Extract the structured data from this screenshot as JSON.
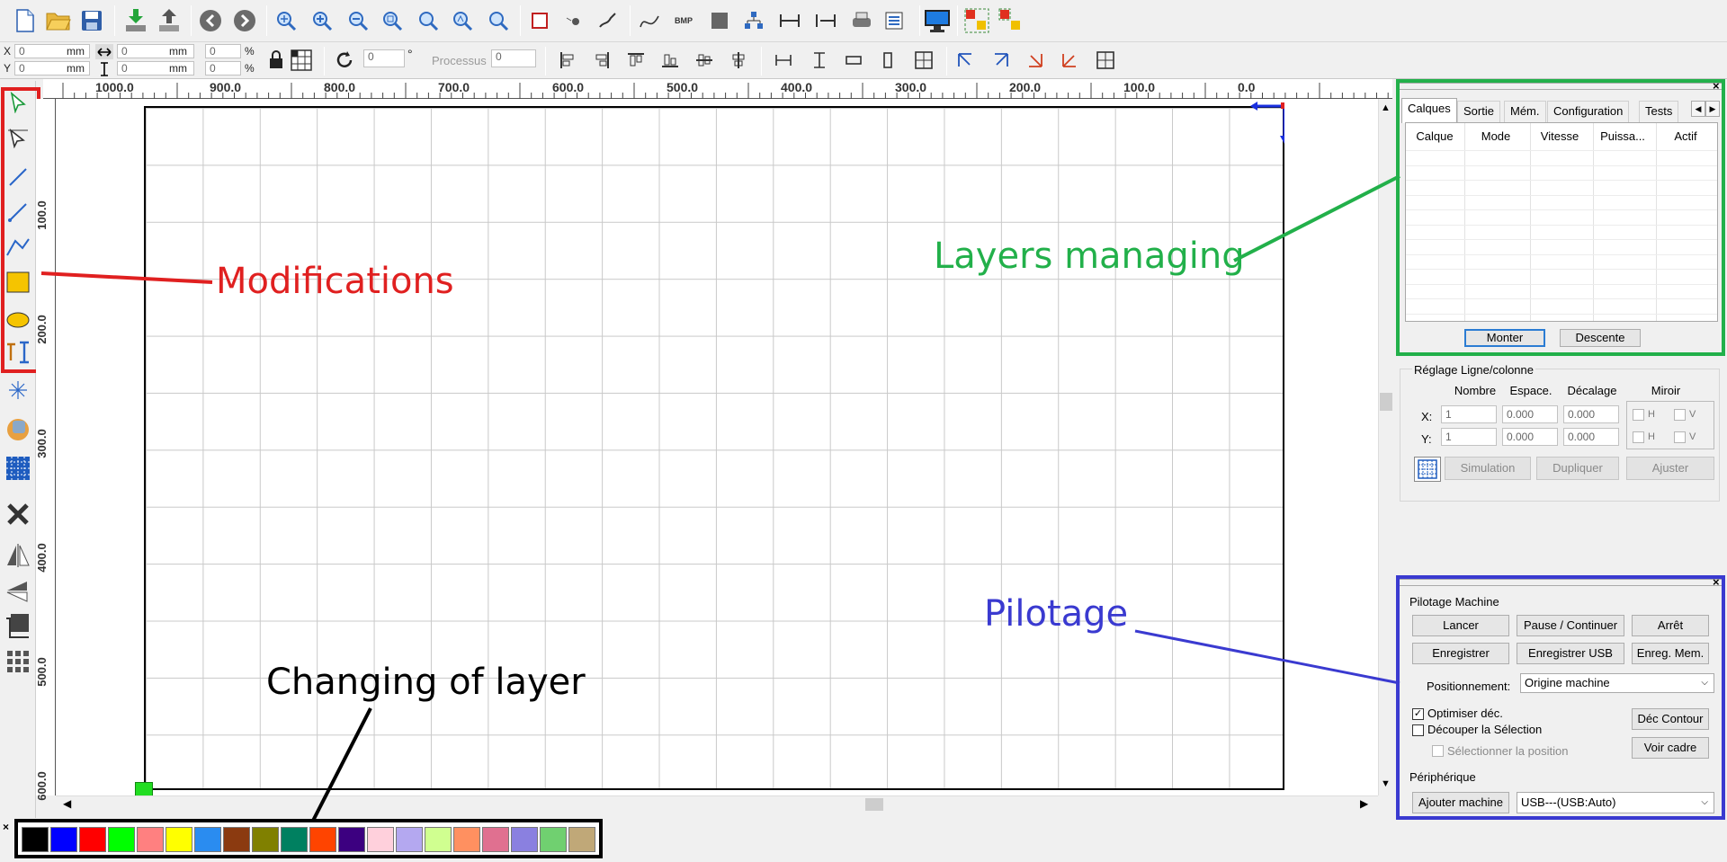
{
  "toolbar_top": {
    "icons": [
      "new-file-icon",
      "open-folder-icon",
      "save-icon",
      "import-icon",
      "export-icon",
      "undo-icon",
      "redo-icon",
      "zoom-pan-icon",
      "zoom-in-icon",
      "zoom-out-icon",
      "zoom-fit-icon",
      "zoom-page-icon",
      "zoom-selection-icon",
      "zoom-actual-icon",
      "rectangle-select-icon",
      "node-icon",
      "edit-curve-icon",
      "bezier-icon",
      "bitmap-icon",
      "fill-icon",
      "tree-icon",
      "dimension-h-icon",
      "dimension-w-icon",
      "printer-icon",
      "list-icon",
      "monitor-icon",
      "group-icon",
      "ungroup-icon"
    ],
    "bmp_label": "BMP"
  },
  "toolbar_second": {
    "x_label": "X",
    "y_label": "Y",
    "x_value": "0",
    "y_value": "0",
    "unit": "mm",
    "w_value": "0",
    "h_value": "0",
    "w_pct": "0",
    "h_pct": "0",
    "pct": "%",
    "rotate_value": "0",
    "degree": "°",
    "processus_label": "Processus",
    "processus_value": "0"
  },
  "left_tools": [
    "select-arrow-icon",
    "node-edit-icon",
    "line-icon",
    "polyline-icon",
    "curve-icon",
    "rectangle-icon",
    "ellipse-icon",
    "text-icon",
    "star-icon",
    "burn-icon",
    "grid-icon",
    "delete-icon",
    "mirror-h-icon",
    "mirror-v-icon",
    "crop-icon",
    "array-icon"
  ],
  "ruler": {
    "top_labels": [
      "1000.0",
      "900.0",
      "800.0",
      "700.0",
      "600.0",
      "500.0",
      "400.0",
      "300.0",
      "200.0",
      "100.0",
      "0.0"
    ],
    "left_labels": [
      "100.0",
      "200.0",
      "300.0",
      "400.0",
      "500.0",
      "600.0"
    ]
  },
  "palette": [
    "#000000",
    "#0000ff",
    "#ff0000",
    "#00ff00",
    "#ff8080",
    "#ffff00",
    "#2a8cf0",
    "#8b3a10",
    "#808000",
    "#008060",
    "#ff4400",
    "#3c0080",
    "#ffd0dc",
    "#b4a8f0",
    "#d0ff90",
    "#ff9060",
    "#e07090",
    "#8a80e0",
    "#70d070",
    "#c0a878"
  ],
  "layers_panel": {
    "tabs": [
      "Calques",
      "Sortie",
      "Mém.",
      "Configuration",
      "Tests"
    ],
    "columns": [
      "Calque",
      "Mode",
      "Vitesse",
      "Puissa...",
      "Actif"
    ],
    "up_button": "Monter",
    "down_button": "Descente"
  },
  "array_panel": {
    "title": "Réglage Ligne/colonne",
    "col_headers": [
      "Nombre",
      "Espace.",
      "Décalage",
      "Miroir"
    ],
    "rows": [
      {
        "label": "X:",
        "count": "1",
        "space": "0.000",
        "offset": "0.000",
        "m1": "H",
        "m2": "V"
      },
      {
        "label": "Y:",
        "count": "1",
        "space": "0.000",
        "offset": "0.000",
        "m1": "H",
        "m2": "V"
      }
    ],
    "buttons": [
      "Simulation",
      "Dupliquer",
      "Ajuster"
    ]
  },
  "machine_panel": {
    "title": "Pilotage Machine",
    "row1": [
      "Lancer",
      "Pause / Continuer",
      "Arrêt"
    ],
    "row2": [
      "Enregistrer",
      "Enregistrer USB",
      "Enreg. Mem."
    ],
    "positioning_label": "Positionnement:",
    "positioning_value": "Origine machine",
    "opt1": "Optimiser déc.",
    "opt2": "Découper la Sélection",
    "opt3": "Sélectionner la position",
    "btn_contour": "Déc Contour",
    "btn_frame": "Voir cadre",
    "periph_title": "Périphérique",
    "add_machine": "Ajouter machine",
    "usb_value": "USB---(USB:Auto)"
  },
  "annotations": {
    "modifications": "Modifications",
    "layers": "Layers managing",
    "pilotage": "Pilotage",
    "changing": "Changing of layer"
  },
  "colors": {
    "red": "#e02020",
    "green": "#22b04a",
    "blue": "#3a3ad0"
  }
}
